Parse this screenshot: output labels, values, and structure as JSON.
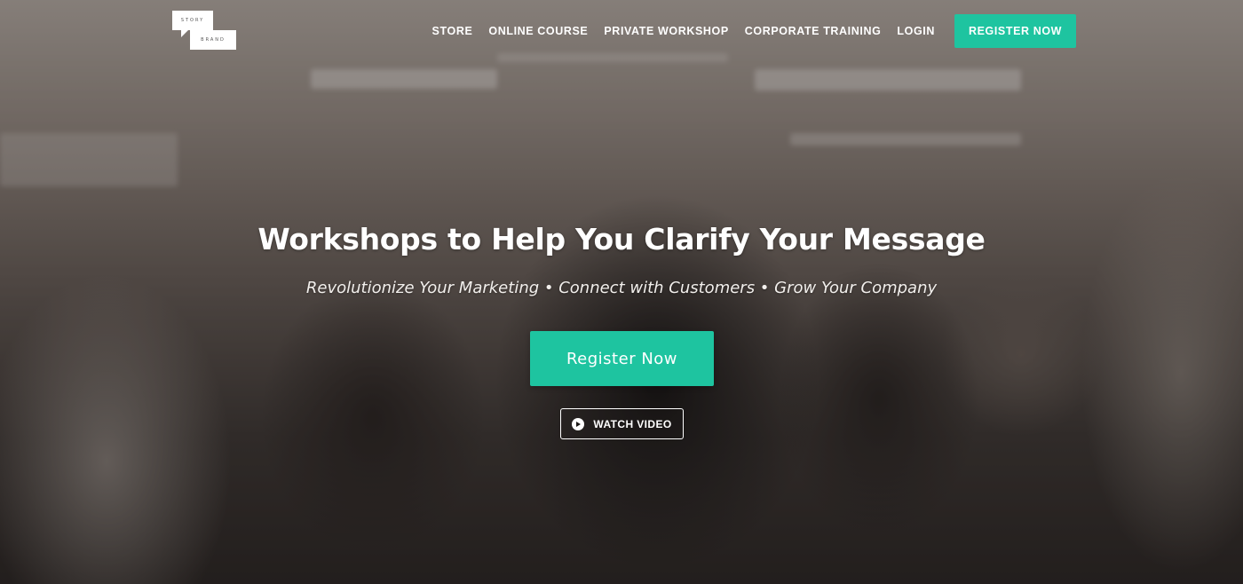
{
  "logo": {
    "top_text": "STORY",
    "bottom_text": "BRAND"
  },
  "nav": {
    "items": [
      {
        "label": "STORE"
      },
      {
        "label": "ONLINE COURSE"
      },
      {
        "label": "PRIVATE WORKSHOP"
      },
      {
        "label": "CORPORATE TRAINING"
      },
      {
        "label": "LOGIN"
      }
    ],
    "cta_label": "REGISTER NOW"
  },
  "hero": {
    "headline": "Workshops to Help You Clarify Your Message",
    "subhead": "Revolutionize Your Marketing • Connect with Customers • Grow Your Company",
    "primary_cta": "Register Now",
    "secondary_cta": "WATCH VIDEO",
    "secondary_icon": "play-circle-icon"
  },
  "colors": {
    "accent": "#1ec4a0",
    "text": "#ffffff",
    "overlay": "#2c2624"
  }
}
